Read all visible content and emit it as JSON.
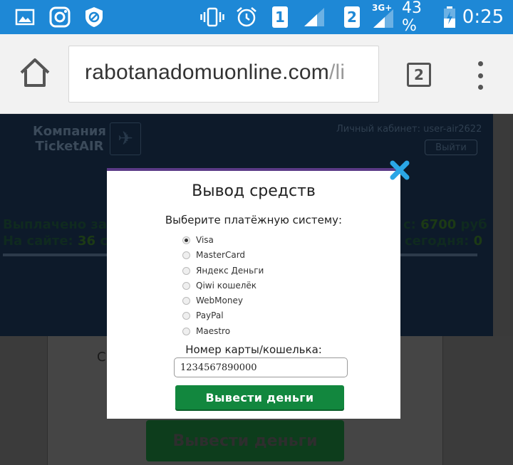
{
  "status_bar": {
    "sim1": "1",
    "sim2": "2",
    "network_type": "3G+",
    "battery_percent": "43 %",
    "time": "0:25",
    "icons": [
      "gallery-icon",
      "instagram-icon",
      "blocked-icon",
      "vibrate-icon",
      "alarm-icon",
      "signal-icon",
      "battery-icon"
    ]
  },
  "browser": {
    "url_domain": "rabotanadomuonline.com",
    "url_path": "/li",
    "tab_count": "2"
  },
  "page": {
    "logo_line1": "Компания",
    "logo_line2": "TicketAIR",
    "cabinet_label": "Личный кабинет: user-air2622",
    "logout_label": "Выйти",
    "paid_label": "Выплачено за се",
    "site_label": "На сайте:",
    "site_count": "36",
    "site_suffix": "сот",
    "right_stat1_label": "с:",
    "right_stat1_value": "6700",
    "right_stat1_unit": "руб",
    "right_stat2_label": "сегодня:",
    "right_stat2_value": "0",
    "partial_text": "С",
    "bg_withdraw_label": "Вывести деньги"
  },
  "modal": {
    "title": "Вывод средств",
    "subtitle": "Выберите платёжную систему:",
    "payment_options": [
      "Visa",
      "MasterCard",
      "Яндекс Деньги",
      "Qiwi кошелёк",
      "WebMoney",
      "PayPal",
      "Maestro"
    ],
    "selected_option": "Visa",
    "card_label": "Номер карты/кошелька:",
    "card_value": "1234567890000",
    "withdraw_label": "Вывести деньги"
  },
  "colors": {
    "status_bar": "#1e88d6",
    "modal_top_border": "#5b3a86",
    "withdraw_button": "#12873e",
    "close_icon": "#2aa6e6"
  }
}
